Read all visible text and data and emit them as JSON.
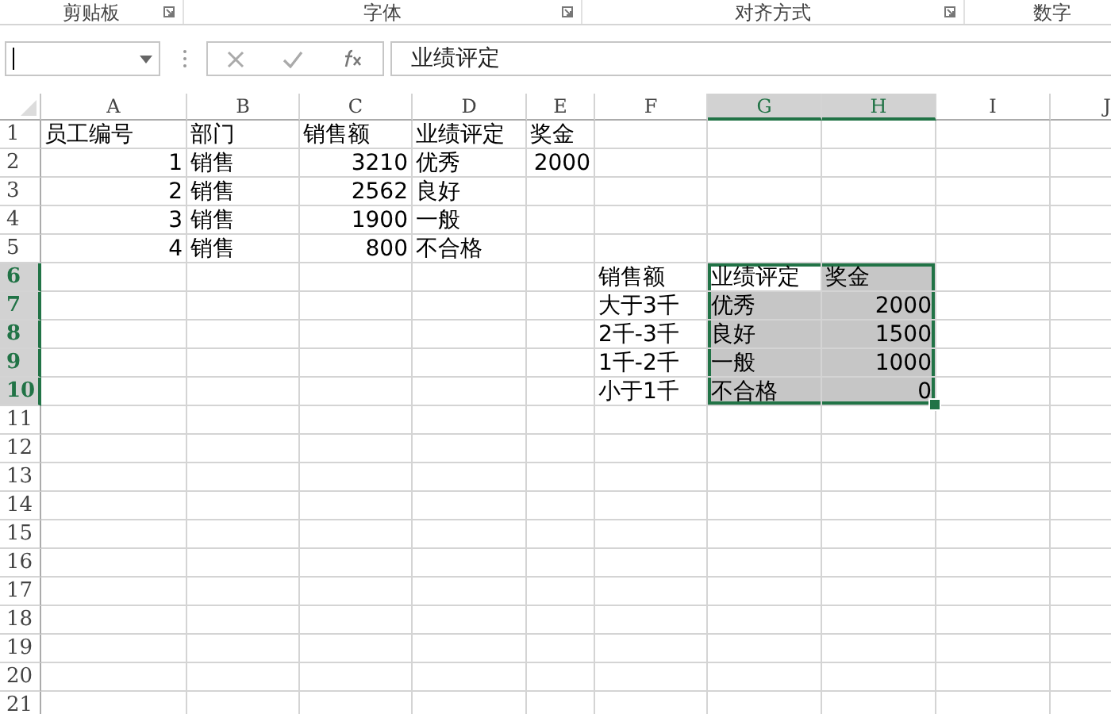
{
  "ribbon_groups": [
    {
      "label": "剪贴板"
    },
    {
      "label": "字体"
    },
    {
      "label": "对齐方式"
    },
    {
      "label": "数字"
    }
  ],
  "formula_bar": {
    "content": "业绩评定"
  },
  "columns": [
    {
      "label": "A",
      "selected": false
    },
    {
      "label": "B",
      "selected": false
    },
    {
      "label": "C",
      "selected": false
    },
    {
      "label": "D",
      "selected": false
    },
    {
      "label": "E",
      "selected": false
    },
    {
      "label": "F",
      "selected": false
    },
    {
      "label": "G",
      "selected": true
    },
    {
      "label": "H",
      "selected": true
    },
    {
      "label": "I",
      "selected": false
    },
    {
      "label": "J",
      "selected": false
    }
  ],
  "rows": [
    {
      "number": "1",
      "selected": false,
      "cells": [
        {
          "text": "员工编号",
          "kind": "text",
          "selected": false,
          "active": false
        },
        {
          "text": "部门",
          "kind": "text",
          "selected": false,
          "active": false
        },
        {
          "text": "销售额",
          "kind": "text",
          "selected": false,
          "active": false
        },
        {
          "text": "业绩评定",
          "kind": "text",
          "selected": false,
          "active": false
        },
        {
          "text": "奖金",
          "kind": "text",
          "selected": false,
          "active": false
        }
      ]
    },
    {
      "number": "2",
      "selected": false,
      "cells": [
        {
          "text": "1",
          "kind": "number",
          "selected": false,
          "active": false
        },
        {
          "text": "销售",
          "kind": "text",
          "selected": false,
          "active": false
        },
        {
          "text": "3210",
          "kind": "number",
          "selected": false,
          "active": false
        },
        {
          "text": "优秀",
          "kind": "text",
          "selected": false,
          "active": false
        },
        {
          "text": "2000",
          "kind": "number",
          "selected": false,
          "active": false
        }
      ]
    },
    {
      "number": "3",
      "selected": false,
      "cells": [
        {
          "text": "2",
          "kind": "number",
          "selected": false,
          "active": false
        },
        {
          "text": "销售",
          "kind": "text",
          "selected": false,
          "active": false
        },
        {
          "text": "2562",
          "kind": "number",
          "selected": false,
          "active": false
        },
        {
          "text": "良好",
          "kind": "text",
          "selected": false,
          "active": false
        }
      ]
    },
    {
      "number": "4",
      "selected": false,
      "cells": [
        {
          "text": "3",
          "kind": "number",
          "selected": false,
          "active": false
        },
        {
          "text": "销售",
          "kind": "text",
          "selected": false,
          "active": false
        },
        {
          "text": "1900",
          "kind": "number",
          "selected": false,
          "active": false
        },
        {
          "text": "一般",
          "kind": "text",
          "selected": false,
          "active": false
        }
      ]
    },
    {
      "number": "5",
      "selected": false,
      "cells": [
        {
          "text": "4",
          "kind": "number",
          "selected": false,
          "active": false
        },
        {
          "text": "销售",
          "kind": "text",
          "selected": false,
          "active": false
        },
        {
          "text": "800",
          "kind": "number",
          "selected": false,
          "active": false
        },
        {
          "text": "不合格",
          "kind": "text",
          "selected": false,
          "active": false
        }
      ]
    },
    {
      "number": "6",
      "selected": true,
      "cells": [
        null,
        null,
        null,
        null,
        null,
        {
          "text": "销售额",
          "kind": "text",
          "selected": false,
          "active": false
        },
        {
          "text": "业绩评定",
          "kind": "text",
          "selected": true,
          "active": true
        },
        {
          "text": "奖金",
          "kind": "text",
          "selected": true,
          "active": false
        }
      ]
    },
    {
      "number": "7",
      "selected": true,
      "cells": [
        null,
        null,
        null,
        null,
        null,
        {
          "text": "大于3千",
          "kind": "text",
          "selected": false,
          "active": false
        },
        {
          "text": "优秀",
          "kind": "text",
          "selected": true,
          "active": false
        },
        {
          "text": "2000",
          "kind": "number",
          "selected": true,
          "active": false
        }
      ]
    },
    {
      "number": "8",
      "selected": true,
      "cells": [
        null,
        null,
        null,
        null,
        null,
        {
          "text": "2千-3千",
          "kind": "text",
          "selected": false,
          "active": false
        },
        {
          "text": "良好",
          "kind": "text",
          "selected": true,
          "active": false
        },
        {
          "text": "1500",
          "kind": "number",
          "selected": true,
          "active": false
        }
      ]
    },
    {
      "number": "9",
      "selected": true,
      "cells": [
        null,
        null,
        null,
        null,
        null,
        {
          "text": "1千-2千",
          "kind": "text",
          "selected": false,
          "active": false
        },
        {
          "text": "一般",
          "kind": "text",
          "selected": true,
          "active": false
        },
        {
          "text": "1000",
          "kind": "number",
          "selected": true,
          "active": false
        }
      ]
    },
    {
      "number": "10",
      "selected": true,
      "cells": [
        null,
        null,
        null,
        null,
        null,
        {
          "text": "小于1千",
          "kind": "text",
          "selected": false,
          "active": false
        },
        {
          "text": "不合格",
          "kind": "text",
          "selected": true,
          "active": false
        },
        {
          "text": "0",
          "kind": "number",
          "selected": true,
          "active": false
        }
      ]
    },
    {
      "number": "11",
      "selected": false
    },
    {
      "number": "12",
      "selected": false
    },
    {
      "number": "13",
      "selected": false
    },
    {
      "number": "14",
      "selected": false
    },
    {
      "number": "15",
      "selected": false
    },
    {
      "number": "16",
      "selected": false
    },
    {
      "number": "17",
      "selected": false
    },
    {
      "number": "18",
      "selected": false
    },
    {
      "number": "19",
      "selected": false
    },
    {
      "number": "20",
      "selected": false
    },
    {
      "number": "21",
      "selected": false
    }
  ]
}
